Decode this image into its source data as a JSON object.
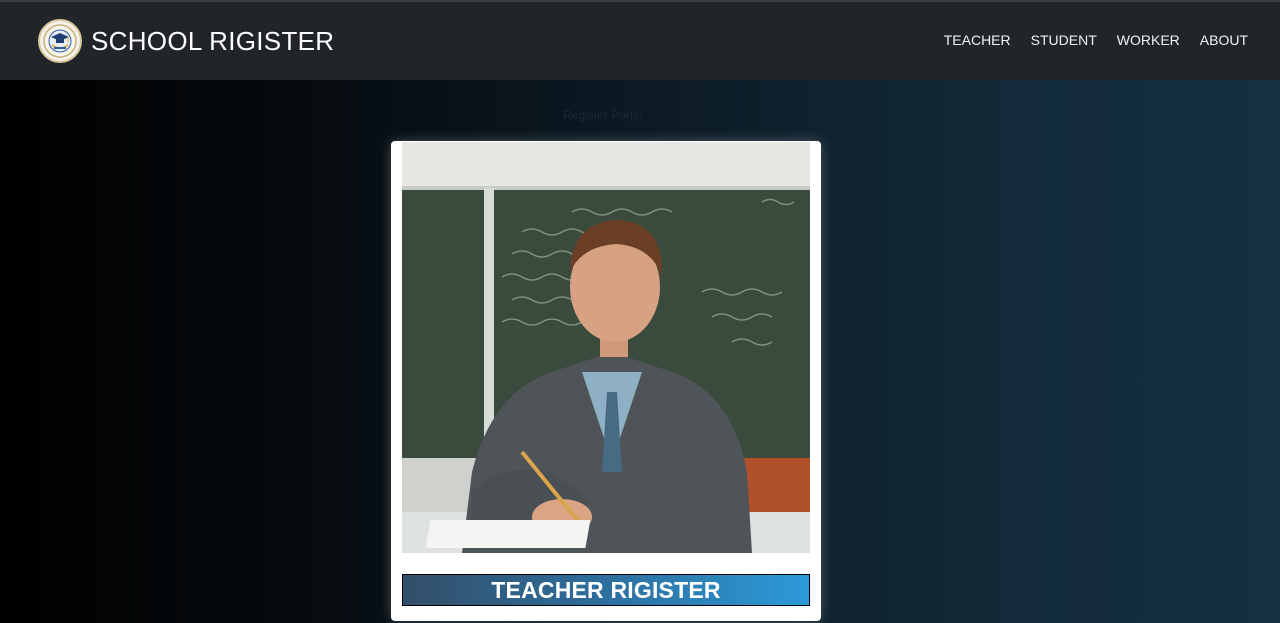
{
  "header": {
    "brand_title": "SCHOOL RIGISTER",
    "nav": [
      {
        "label": "TEACHER"
      },
      {
        "label": "STUDENT"
      },
      {
        "label": "WORKER"
      },
      {
        "label": "ABOUT"
      }
    ]
  },
  "hero": {
    "caption": "Register Portal",
    "card": {
      "image_icon": "teacher-photo",
      "button_label": "TEACHER RIGISTER"
    }
  },
  "colors": {
    "navbar": "#212429",
    "button_start": "#334e68",
    "button_end": "#2c9ad8"
  }
}
